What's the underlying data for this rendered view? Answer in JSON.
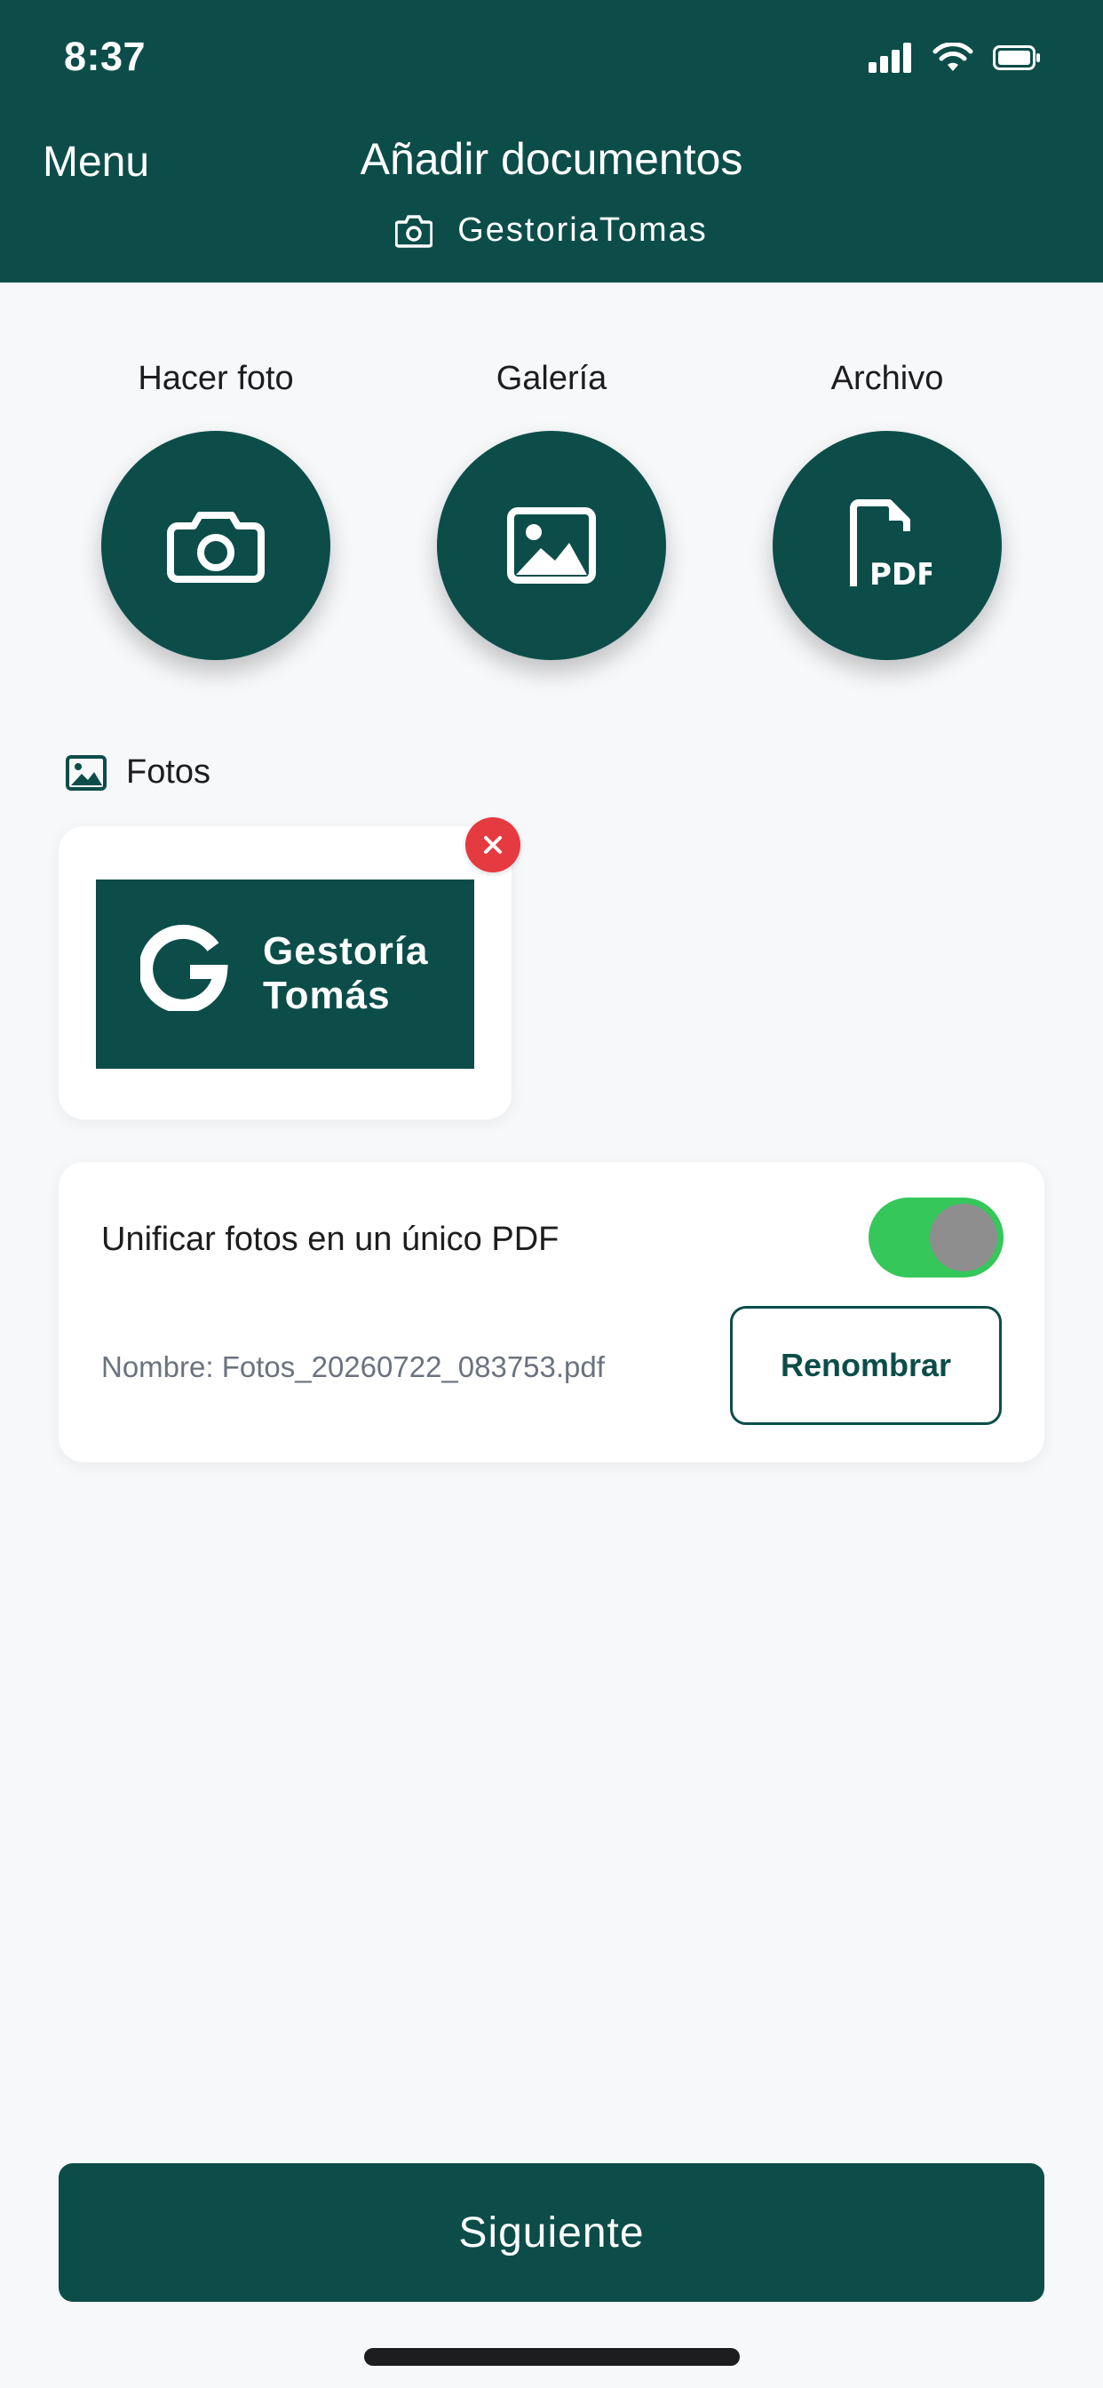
{
  "status_bar": {
    "time": "8:37"
  },
  "header": {
    "menu_label": "Menu",
    "title": "Añadir documentos",
    "subtitle": "GestoriaTomas"
  },
  "actions": [
    {
      "label": "Hacer foto",
      "icon": "camera-icon"
    },
    {
      "label": "Galería",
      "icon": "image-icon"
    },
    {
      "label": "Archivo",
      "icon": "pdf-file-icon"
    }
  ],
  "photos": {
    "heading": "Fotos",
    "items": [
      {
        "thumbnail_text_line1": "Gestoría",
        "thumbnail_text_line2": "Tomás"
      }
    ]
  },
  "unify": {
    "label": "Unificar fotos en un único PDF",
    "enabled": true,
    "filename_text": "Nombre: Fotos_20260722_083753.pdf",
    "rename_label": "Renombrar"
  },
  "footer": {
    "next_label": "Siguiente"
  },
  "colors": {
    "primary": "#0c4d4a",
    "toggle_on": "#35c759",
    "danger": "#e53a40",
    "background": "#f7f8fa"
  }
}
